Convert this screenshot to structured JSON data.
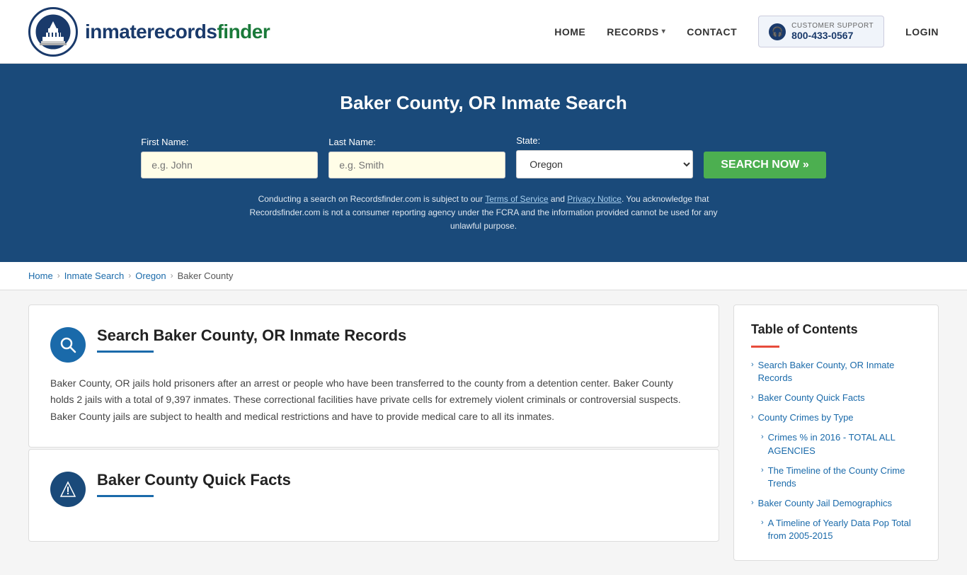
{
  "header": {
    "logo_text_main": "inmaterecords",
    "logo_text_bold": "finder",
    "nav": {
      "home": "HOME",
      "records": "RECORDS",
      "contact": "CONTACT",
      "login": "LOGIN"
    },
    "support": {
      "label": "CUSTOMER SUPPORT",
      "number": "800-433-0567"
    }
  },
  "hero": {
    "title": "Baker County, OR Inmate Search",
    "form": {
      "first_name_label": "First Name:",
      "first_name_placeholder": "e.g. John",
      "last_name_label": "Last Name:",
      "last_name_placeholder": "e.g. Smith",
      "state_label": "State:",
      "state_value": "Oregon",
      "search_button": "SEARCH NOW »"
    },
    "disclaimer": "Conducting a search on Recordsfinder.com is subject to our Terms of Service and Privacy Notice. You acknowledge that Recordsfinder.com is not a consumer reporting agency under the FCRA and the information provided cannot be used for any unlawful purpose."
  },
  "breadcrumb": {
    "home": "Home",
    "inmate_search": "Inmate Search",
    "state": "Oregon",
    "county": "Baker County"
  },
  "main": {
    "section1": {
      "title": "Search Baker County, OR Inmate Records",
      "body": "Baker County, OR jails hold prisoners after an arrest or people who have been transferred to the county from a detention center. Baker County holds 2 jails with a total of 9,397 inmates. These correctional facilities have private cells for extremely violent criminals or controversial suspects. Baker County jails are subject to health and medical restrictions and have to provide medical care to all its inmates."
    },
    "section2": {
      "title": "Baker County Quick Facts"
    }
  },
  "toc": {
    "title": "Table of Contents",
    "items": [
      {
        "label": "Search Baker County, OR Inmate Records",
        "sub": false
      },
      {
        "label": "Baker County Quick Facts",
        "sub": false
      },
      {
        "label": "County Crimes by Type",
        "sub": false
      },
      {
        "label": "Crimes % in 2016 - TOTAL ALL AGENCIES",
        "sub": true
      },
      {
        "label": "The Timeline of the County Crime Trends",
        "sub": true
      },
      {
        "label": "Baker County Jail Demographics",
        "sub": false
      },
      {
        "label": "A Timeline of Yearly Data Pop Total from 2005-2015",
        "sub": true
      }
    ]
  }
}
